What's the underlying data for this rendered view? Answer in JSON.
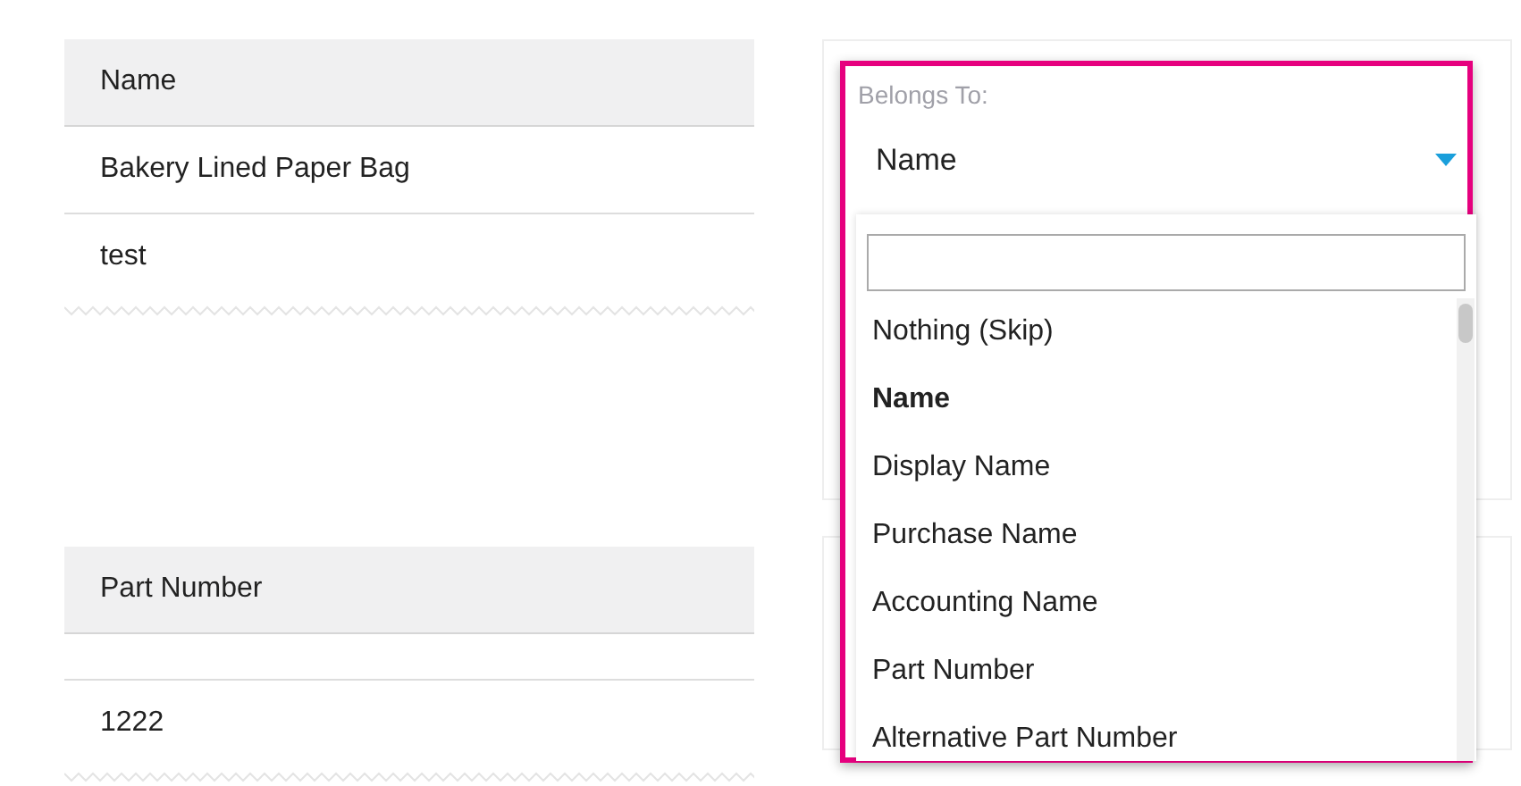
{
  "tables": [
    {
      "header": "Name",
      "rows": [
        {
          "kind": "value",
          "text": "Bakery Lined Paper Bag"
        },
        {
          "kind": "value",
          "text": "test"
        }
      ]
    },
    {
      "header": "Part Number",
      "rows": [
        {
          "kind": "blank"
        },
        {
          "kind": "value",
          "text": "1222"
        }
      ]
    }
  ],
  "mapping": {
    "label": "Belongs To:",
    "value": "Name",
    "expanded": true,
    "highlighted": true,
    "options": [
      {
        "label": "Nothing (Skip)",
        "selected": false
      },
      {
        "label": "Name",
        "selected": true
      },
      {
        "label": "Display Name",
        "selected": false
      },
      {
        "label": "Purchase Name",
        "selected": false
      },
      {
        "label": "Accounting Name",
        "selected": false
      },
      {
        "label": "Part Number",
        "selected": false
      },
      {
        "label": "Alternative Part Number",
        "selected": false
      }
    ]
  }
}
